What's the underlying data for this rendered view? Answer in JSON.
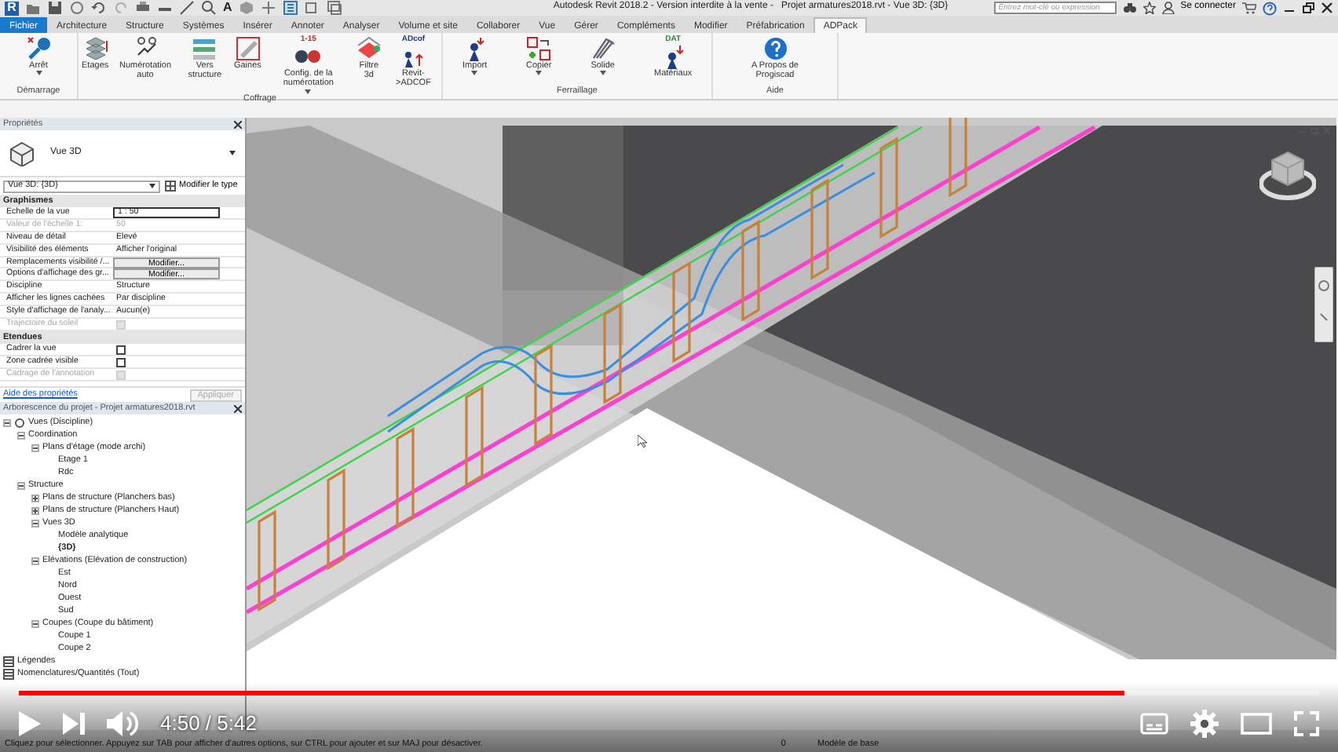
{
  "title_bar": {
    "logo": "R",
    "text_tool": "A",
    "title": "Autodesk Revit 2018.2 - Version interdite à la vente -   Projet armatures2018.rvt - Vue 3D: {3D}",
    "search": {
      "placeholder": "Entrez mot-clé ou expression"
    },
    "sign_in": "Se connecter"
  },
  "ribbon_tabs": [
    {
      "label": "Fichier",
      "kind": "file",
      "selected": false
    },
    {
      "label": "Architecture",
      "kind": "tab",
      "selected": false
    },
    {
      "label": "Structure",
      "kind": "tab",
      "selected": false
    },
    {
      "label": "Systèmes",
      "kind": "tab",
      "selected": false
    },
    {
      "label": "Insérer",
      "kind": "tab",
      "selected": false
    },
    {
      "label": "Annoter",
      "kind": "tab",
      "selected": false
    },
    {
      "label": "Analyser",
      "kind": "tab",
      "selected": false
    },
    {
      "label": "Volume et site",
      "kind": "tab",
      "selected": false
    },
    {
      "label": "Collaborer",
      "kind": "tab",
      "selected": false
    },
    {
      "label": "Vue",
      "kind": "tab",
      "selected": false
    },
    {
      "label": "Gérer",
      "kind": "tab",
      "selected": false
    },
    {
      "label": "Compléments",
      "kind": "tab",
      "selected": false
    },
    {
      "label": "Modifier",
      "kind": "tab",
      "selected": false
    },
    {
      "label": "Préfabrication",
      "kind": "tab",
      "selected": false
    },
    {
      "label": "ADPack",
      "kind": "tab",
      "selected": true
    }
  ],
  "ribbon_panels": [
    {
      "label": "Démarrage",
      "buttons": [
        {
          "label": "Arrêt",
          "dropdown": true
        }
      ]
    },
    {
      "label": "Coffrage",
      "buttons": [
        {
          "label": "Etages",
          "dropdown": false
        },
        {
          "label": "Numérotation auto",
          "dropdown": false
        },
        {
          "label": "Vers structure",
          "dropdown": false
        },
        {
          "label": "Gaines",
          "dropdown": false
        },
        {
          "label": "Config. de la numérotation",
          "dropdown": true,
          "icon_text": "1-15"
        },
        {
          "label": "Filtre 3d",
          "dropdown": false
        },
        {
          "label": "Revit->ADCOF",
          "dropdown": false,
          "icon_text": "ADcof"
        }
      ]
    },
    {
      "label": "Ferraillage",
      "buttons": [
        {
          "label": "Import",
          "dropdown": true
        },
        {
          "label": "Copier",
          "dropdown": true
        },
        {
          "label": "Solide",
          "dropdown": true
        },
        {
          "label": "Matériaux",
          "dropdown": false,
          "icon_text": "DAT"
        }
      ]
    },
    {
      "label": "Aide",
      "buttons": [
        {
          "label": "A Propos de Progiscad",
          "dropdown": false
        }
      ]
    }
  ],
  "properties": {
    "title": "Propriétés",
    "type_name": "Vue 3D",
    "instance_selector": "Vue 3D: {3D}",
    "edit_type": "Modifier le type",
    "sections": [
      {
        "name": "Graphismes",
        "rows": [
          {
            "label": "Echelle de la vue",
            "kind": "input",
            "value": "1 : 50",
            "disabled": false
          },
          {
            "label": "Valeur de l'échelle    1:",
            "kind": "text",
            "value": "50",
            "disabled": true
          },
          {
            "label": "Niveau de détail",
            "kind": "text",
            "value": "Elevé",
            "disabled": false
          },
          {
            "label": "Visibilité des éléments",
            "kind": "text",
            "value": "Afficher l'original",
            "disabled": false
          },
          {
            "label": "Remplacements visibilité /...",
            "kind": "button",
            "value": "Modifier...",
            "disabled": false
          },
          {
            "label": "Options d'affichage des gr...",
            "kind": "button",
            "value": "Modifier...",
            "disabled": false
          },
          {
            "label": "Discipline",
            "kind": "text",
            "value": "Structure",
            "disabled": false
          },
          {
            "label": "Afficher les lignes cachées",
            "kind": "text",
            "value": "Par discipline",
            "disabled": false
          },
          {
            "label": "Style d'affichage de l'analy...",
            "kind": "text",
            "value": "Aucun(e)",
            "disabled": false
          },
          {
            "label": "Trajectoire du soleil",
            "kind": "checkbox",
            "checked": false,
            "disabled": true
          }
        ]
      },
      {
        "name": "Etendues",
        "rows": [
          {
            "label": "Cadrer la vue",
            "kind": "checkbox",
            "checked": false,
            "disabled": false
          },
          {
            "label": "Zone cadrée visible",
            "kind": "checkbox",
            "checked": false,
            "disabled": false
          },
          {
            "label": "Cadrage de l'annotation",
            "kind": "checkbox",
            "checked": false,
            "disabled": true
          }
        ]
      }
    ],
    "help_link": "Aide des propriétés",
    "apply": "Appliquer"
  },
  "project_browser": {
    "title": "Arborescence du projet - Projet armatures2018.rvt",
    "tree": [
      {
        "label": "Vues (Discipline)",
        "expanded": true,
        "children": [
          {
            "label": "Coordination",
            "expanded": true,
            "children": [
              {
                "label": "Plans d'étage (mode archi)",
                "expanded": true,
                "children": [
                  {
                    "label": "Etage 1",
                    "active": false
                  },
                  {
                    "label": "Rdc",
                    "active": false
                  }
                ]
              }
            ]
          },
          {
            "label": "Structure",
            "expanded": true,
            "children": [
              {
                "label": "Plans de structure (Planchers bas)",
                "expanded": false
              },
              {
                "label": "Plans de structure (Planchers Haut)",
                "expanded": false
              },
              {
                "label": "Vues 3D",
                "expanded": true,
                "children": [
                  {
                    "label": "Modèle analytique",
                    "active": false
                  },
                  {
                    "label": "{3D}",
                    "active": true
                  }
                ]
              },
              {
                "label": "Elévations (Elévation de construction)",
                "expanded": true,
                "children": [
                  {
                    "label": "Est",
                    "active": false
                  },
                  {
                    "label": "Nord",
                    "active": false
                  },
                  {
                    "label": "Ouest",
                    "active": false
                  },
                  {
                    "label": "Sud",
                    "active": false
                  }
                ]
              },
              {
                "label": "Coupes (Coupe du bâtiment)",
                "expanded": true,
                "children": [
                  {
                    "label": "Coupe 1",
                    "active": false
                  },
                  {
                    "label": "Coupe 2",
                    "active": false
                  }
                ]
              }
            ]
          }
        ]
      },
      {
        "label": "Légendes",
        "kind": "category"
      },
      {
        "label": "Nomenclatures/Quantités (Tout)",
        "kind": "category"
      }
    ]
  },
  "status_bar": {
    "message": "Cliquez pour sélectionner. Appuyez sur TAB pour afficher d'autres options, sur CTRL pour ajouter et sur MAJ pour désactiver.",
    "selection_count": "0",
    "model": "Modèle de base"
  },
  "video_player": {
    "progress": {
      "level": 0.85
    },
    "time": "4:50 / 5:42"
  }
}
